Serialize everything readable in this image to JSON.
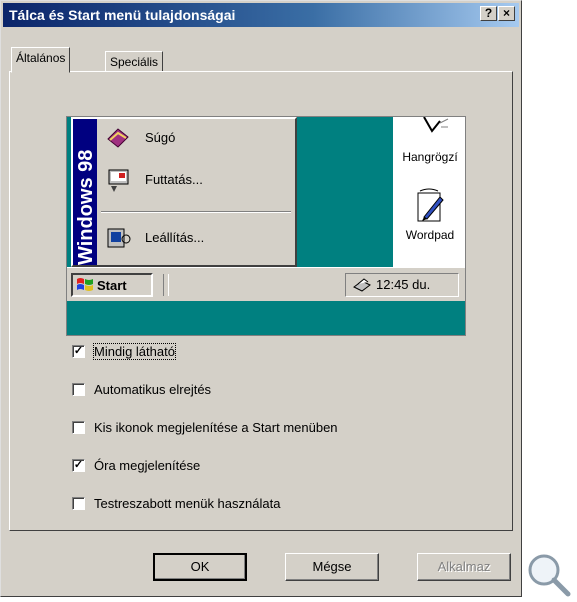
{
  "window": {
    "title": "Tálca és Start menü tulajdonságai",
    "help_glyph": "?",
    "close_glyph": "×"
  },
  "tabs": [
    {
      "label": "Általános",
      "active": true
    },
    {
      "label": "Speciális",
      "active": false
    }
  ],
  "preview": {
    "sidebar_text": "Windows 98",
    "menu_items": [
      {
        "label": "Súgó",
        "icon": "help-book-icon"
      },
      {
        "label": "Futtatás...",
        "icon": "run-icon"
      },
      {
        "label": "Leállítás...",
        "icon": "shutdown-icon"
      }
    ],
    "desktop_icons": [
      {
        "label": "Hangrögzí",
        "icon": "sound-recorder-icon"
      },
      {
        "label": "Wordpad",
        "icon": "wordpad-icon"
      }
    ],
    "start_label": "Start",
    "clock": "12:45 du."
  },
  "options": [
    {
      "label": "Mindig látható",
      "checked": true
    },
    {
      "label": "Automatikus elrejtés",
      "checked": false
    },
    {
      "label": "Kis ikonok megjelenítése a Start menüben",
      "checked": false
    },
    {
      "label": "Óra megjelenítése",
      "checked": true
    },
    {
      "label": "Testreszabott menük használata",
      "checked": false
    }
  ],
  "buttons": {
    "ok": "OK",
    "cancel": "Mégse",
    "apply": "Alkalmaz"
  },
  "colors": {
    "titlebar": "#0a246a",
    "desktop": "#008080",
    "face": "#d4d0c8"
  }
}
